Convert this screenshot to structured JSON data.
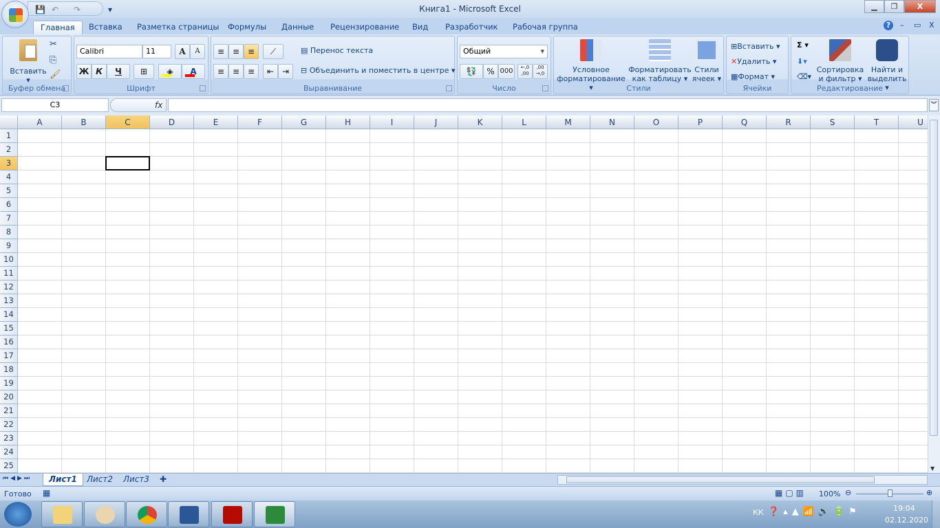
{
  "window": {
    "title": "Книга1 - Microsoft Excel",
    "minimize": "▁",
    "restore": "❐",
    "close": "X"
  },
  "qat": {
    "save": "💾",
    "undo": "↶",
    "redo": "↷",
    "more": "▾"
  },
  "tabs": [
    "Главная",
    "Вставка",
    "Разметка страницы",
    "Формулы",
    "Данные",
    "Рецензирование",
    "Вид",
    "Разработчик",
    "Рабочая группа"
  ],
  "ribbon_right": {
    "help": "?",
    "min": "–",
    "restore": "▭",
    "close": "X"
  },
  "clipboard": {
    "paste": "Вставить",
    "label": "Буфер обмена"
  },
  "font": {
    "name": "Calibri",
    "size": "11",
    "grow": "A",
    "shrink": "A",
    "bold": "Ж",
    "italic": "К",
    "underline": "Ч",
    "fill_color": "#ffff00",
    "font_color": "#ff0000",
    "label": "Шрифт"
  },
  "alignment": {
    "wrap": "Перенос текста",
    "merge": "Объединить и поместить в центре",
    "label": "Выравнивание"
  },
  "number": {
    "format": "Общий",
    "percent": "%",
    "thousands": "000",
    "inc": "←,0 ,00",
    "dec": ",00 →,0",
    "label": "Число"
  },
  "styles": {
    "conditional": [
      "Условное",
      "форматирование ▾"
    ],
    "table": [
      "Форматировать",
      "как таблицу ▾"
    ],
    "cell": [
      "Стили",
      "ячеек ▾"
    ],
    "label": "Стили"
  },
  "cells": {
    "insert": "Вставить ▾",
    "delete": "Удалить ▾",
    "format": "Формат ▾",
    "label": "Ячейки"
  },
  "editing": {
    "sum": "Σ ▾",
    "sort": [
      "Сортировка",
      "и фильтр ▾"
    ],
    "find": [
      "Найти и",
      "выделить ▾"
    ],
    "label": "Редактирование"
  },
  "formula_bar": {
    "name_box": "C3",
    "fx": "fx",
    "value": ""
  },
  "sheet": {
    "columns": [
      "A",
      "B",
      "C",
      "D",
      "E",
      "F",
      "G",
      "H",
      "I",
      "J",
      "K",
      "L",
      "M",
      "N",
      "O",
      "P",
      "Q",
      "R",
      "S",
      "T",
      "U"
    ],
    "rows": 25,
    "active_col": "C",
    "active_row": 3
  },
  "sheet_tabs": [
    "Лист1",
    "Лист2",
    "Лист3"
  ],
  "status": {
    "ready": "Готово",
    "zoom": "100%"
  },
  "tray": {
    "lang": "КК",
    "time": "19:04",
    "date": "02.12.2020"
  }
}
